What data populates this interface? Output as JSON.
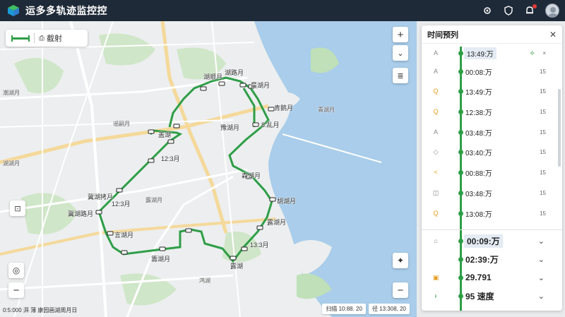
{
  "app": {
    "title": "运多多轨迹监控控"
  },
  "toolbar": {
    "chip_label": "截射"
  },
  "map": {
    "labels": [
      {
        "text": "湖顺月",
        "id": "l1"
      },
      {
        "text": "湖路月",
        "id": "l2"
      },
      {
        "text": "晨湖月",
        "id": "l3"
      },
      {
        "text": "青鹅月",
        "id": "l4"
      },
      {
        "text": "豫湖月",
        "id": "l5"
      },
      {
        "text": "8:乱月",
        "id": "l6"
      },
      {
        "text": "盖湖",
        "id": "l7"
      },
      {
        "text": "12:3月",
        "id": "l8"
      },
      {
        "text": "冀湖拷月",
        "id": "l9"
      },
      {
        "text": "12:3月",
        "id": "l10"
      },
      {
        "text": "冀湖路月",
        "id": "l11"
      },
      {
        "text": "言湖月",
        "id": "l12"
      },
      {
        "text": "森湖月",
        "id": "l13"
      },
      {
        "text": "胡湖月",
        "id": "l14"
      },
      {
        "text": "露湖月",
        "id": "l15"
      },
      {
        "text": "13:3月",
        "id": "l16"
      },
      {
        "text": "籌湖月",
        "id": "l17"
      },
      {
        "text": "露湖",
        "id": "l18"
      },
      {
        "text": "鸿湖",
        "id": "l19"
      },
      {
        "text": "谣嗣月",
        "id": "l20"
      },
      {
        "text": "潮湖月",
        "id": "l21"
      },
      {
        "text": "露湖月",
        "id": "l22"
      },
      {
        "text": "湖湖月",
        "id": "l23"
      },
      {
        "text": "青湖月",
        "id": "l24"
      }
    ],
    "bottom_left": "0:5:000  湃    薄 康园画湖周月日",
    "bottom_right": [
      "扫描 10:88. 20",
      "径 13:308, 20"
    ],
    "route_color": "#2e9e47"
  },
  "panel": {
    "title": "时间预列",
    "rows": [
      {
        "icon": "A",
        "time": "13:49:万",
        "right": "×",
        "extra": "⟡"
      },
      {
        "icon": "A",
        "time": "00:08:万",
        "right": "15"
      },
      {
        "icon": "Q",
        "time": "13:49:万",
        "right": "15"
      },
      {
        "icon": "Q",
        "time": "12:38:万",
        "right": "15"
      },
      {
        "icon": "A",
        "time": "03:48:万",
        "right": "15"
      },
      {
        "icon": "◇",
        "time": "03:40:万",
        "right": "15"
      },
      {
        "icon": "<",
        "time": "00:88:万",
        "right": "15"
      },
      {
        "icon": "◫",
        "time": "03:48:万",
        "right": "15"
      },
      {
        "icon": "Q",
        "time": "13:08:万",
        "right": "15"
      }
    ],
    "rows2": [
      {
        "icon": "⌂",
        "time": "00:09:万"
      },
      {
        "icon": "",
        "time": "02:39:万"
      },
      {
        "icon": "▣",
        "time": "29.791"
      },
      {
        "icon": "ᵼ",
        "time": "95 速度"
      }
    ]
  }
}
